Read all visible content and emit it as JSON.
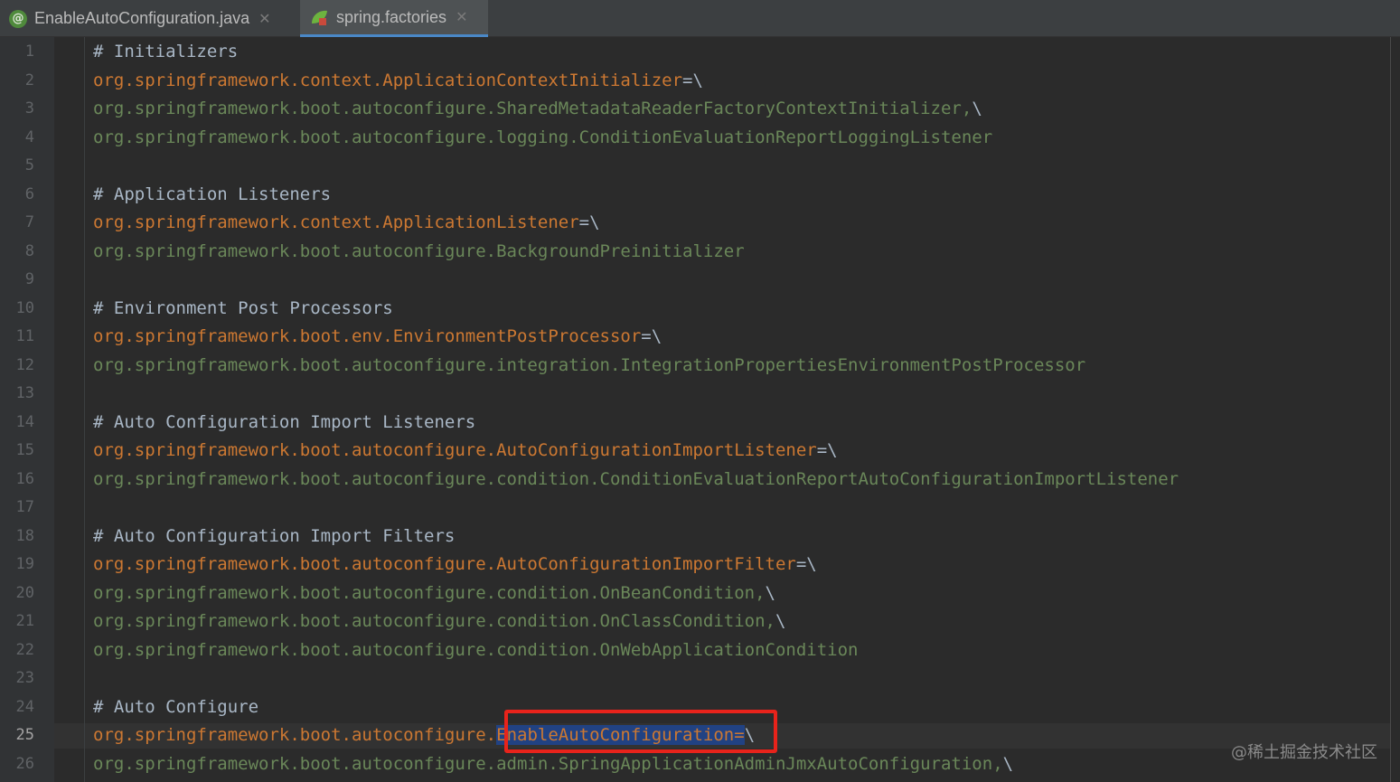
{
  "tabs": [
    {
      "label": "EnableAutoConfiguration.java",
      "icon": "java-annotation-icon",
      "active": false
    },
    {
      "label": "spring.factories",
      "icon": "spring-leaf-icon",
      "active": true
    }
  ],
  "current_line_number": 25,
  "lines": [
    {
      "n": "1",
      "parts": [
        {
          "t": "# Initializers",
          "c": "comment"
        }
      ]
    },
    {
      "n": "2",
      "parts": [
        {
          "t": "org.springframework.context.ApplicationContextInitializer",
          "c": "key"
        },
        {
          "t": "=\\",
          "c": "op"
        }
      ]
    },
    {
      "n": "3",
      "parts": [
        {
          "t": "org.springframework.boot.autoconfigure.SharedMetadataReaderFactoryContextInitializer,",
          "c": "val"
        },
        {
          "t": "\\",
          "c": "op"
        }
      ]
    },
    {
      "n": "4",
      "parts": [
        {
          "t": "org.springframework.boot.autoconfigure.logging.ConditionEvaluationReportLoggingListener",
          "c": "val"
        }
      ]
    },
    {
      "n": "5",
      "parts": []
    },
    {
      "n": "6",
      "parts": [
        {
          "t": "# Application Listeners",
          "c": "comment"
        }
      ]
    },
    {
      "n": "7",
      "parts": [
        {
          "t": "org.springframework.context.ApplicationListener",
          "c": "key"
        },
        {
          "t": "=\\",
          "c": "op"
        }
      ]
    },
    {
      "n": "8",
      "parts": [
        {
          "t": "org.springframework.boot.autoconfigure.BackgroundPreinitializer",
          "c": "val"
        }
      ]
    },
    {
      "n": "9",
      "parts": []
    },
    {
      "n": "10",
      "parts": [
        {
          "t": "# Environment Post Processors",
          "c": "comment"
        }
      ]
    },
    {
      "n": "11",
      "parts": [
        {
          "t": "org.springframework.boot.env.EnvironmentPostProcessor",
          "c": "key"
        },
        {
          "t": "=\\",
          "c": "op"
        }
      ]
    },
    {
      "n": "12",
      "parts": [
        {
          "t": "org.springframework.boot.autoconfigure.integration.IntegrationPropertiesEnvironmentPostProcessor",
          "c": "val"
        }
      ]
    },
    {
      "n": "13",
      "parts": []
    },
    {
      "n": "14",
      "parts": [
        {
          "t": "# Auto Configuration Import Listeners",
          "c": "comment"
        }
      ]
    },
    {
      "n": "15",
      "parts": [
        {
          "t": "org.springframework.boot.autoconfigure.AutoConfigurationImportListener",
          "c": "key"
        },
        {
          "t": "=\\",
          "c": "op"
        }
      ]
    },
    {
      "n": "16",
      "parts": [
        {
          "t": "org.springframework.boot.autoconfigure.condition.ConditionEvaluationReportAutoConfigurationImportListener",
          "c": "val"
        }
      ]
    },
    {
      "n": "17",
      "parts": []
    },
    {
      "n": "18",
      "parts": [
        {
          "t": "# Auto Configuration Import Filters",
          "c": "comment"
        }
      ]
    },
    {
      "n": "19",
      "parts": [
        {
          "t": "org.springframework.boot.autoconfigure.AutoConfigurationImportFilter",
          "c": "key"
        },
        {
          "t": "=\\",
          "c": "op"
        }
      ]
    },
    {
      "n": "20",
      "parts": [
        {
          "t": "org.springframework.boot.autoconfigure.condition.OnBeanCondition,",
          "c": "val"
        },
        {
          "t": "\\",
          "c": "op"
        }
      ]
    },
    {
      "n": "21",
      "parts": [
        {
          "t": "org.springframework.boot.autoconfigure.condition.OnClassCondition,",
          "c": "val"
        },
        {
          "t": "\\",
          "c": "op"
        }
      ]
    },
    {
      "n": "22",
      "parts": [
        {
          "t": "org.springframework.boot.autoconfigure.condition.OnWebApplicationCondition",
          "c": "val"
        }
      ]
    },
    {
      "n": "23",
      "parts": []
    },
    {
      "n": "24",
      "parts": [
        {
          "t": "# Auto Configure",
          "c": "comment"
        }
      ]
    },
    {
      "n": "25",
      "parts": [
        {
          "t": "org.springframework.boot.autoconfigure.",
          "c": "key"
        },
        {
          "t": "EnableAutoConfiguration",
          "c": "sel"
        },
        {
          "t": "=",
          "c": "sel"
        },
        {
          "t": "\\",
          "c": "op"
        }
      ]
    },
    {
      "n": "26",
      "parts": [
        {
          "t": "org.springframework.boot.autoconfigure.admin.SpringApplicationAdminJmxAutoConfiguration,",
          "c": "val"
        },
        {
          "t": "\\",
          "c": "op"
        }
      ]
    }
  ],
  "watermark": "@稀土掘金技术社区",
  "colors": {
    "comment": "#a9b7c6",
    "key": "#cc7832",
    "value": "#6a8759",
    "selection": "#214283",
    "highlight_box": "#e8231b",
    "tab_underline": "#4a88c7"
  }
}
